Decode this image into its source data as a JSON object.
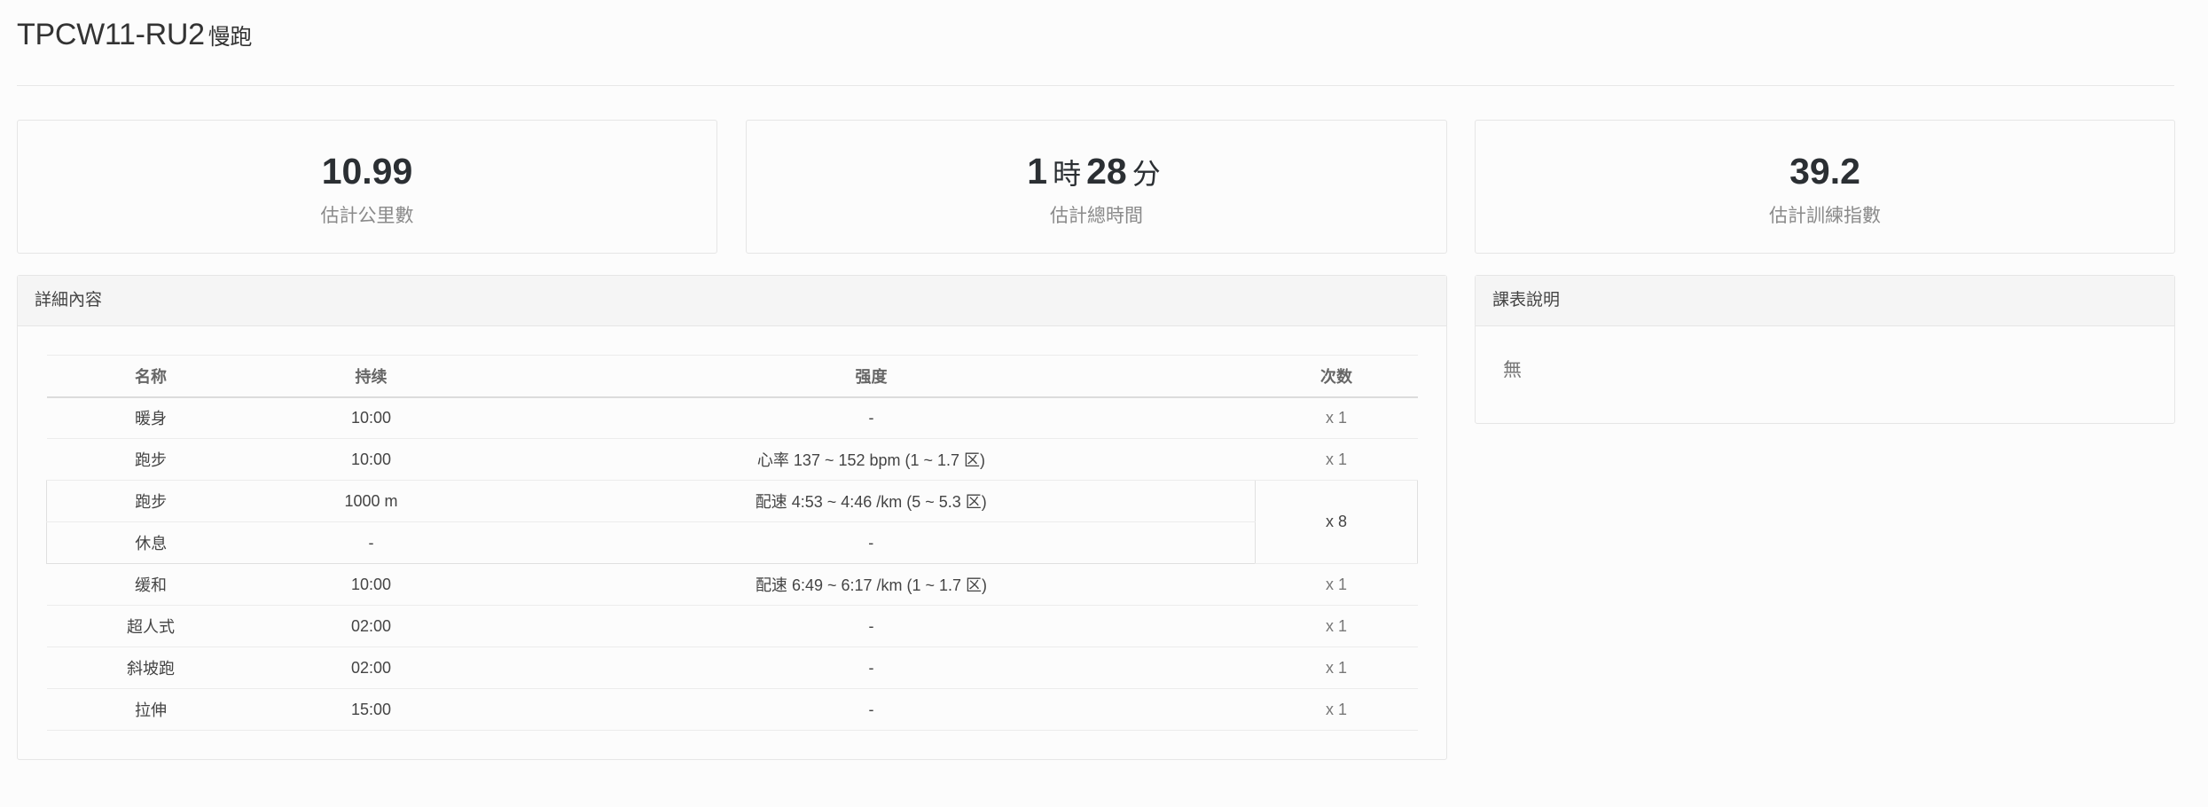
{
  "header": {
    "code": "TPCW11-RU2",
    "type": "慢跑"
  },
  "stats": {
    "distance": {
      "value": "10.99",
      "label": "估計公里數"
    },
    "duration": {
      "hours": "1",
      "hours_unit": "時",
      "minutes": "28",
      "minutes_unit": "分",
      "label": "估計總時間"
    },
    "training_index": {
      "value": "39.2",
      "label": "估計訓練指數"
    }
  },
  "details": {
    "heading": "詳細內容",
    "columns": [
      "名称",
      "持续",
      "强度",
      "次数"
    ],
    "rows": [
      {
        "name": "暖身",
        "duration": "10:00",
        "intensity": "-",
        "count": "x 1"
      },
      {
        "name": "跑步",
        "duration": "10:00",
        "intensity": "心率 137 ~ 152 bpm (1 ~ 1.7 区)",
        "count": "x 1"
      },
      {
        "name": "跑步",
        "duration": "1000 m",
        "intensity": "配速 4:53 ~ 4:46 /km (5 ~ 5.3 区)",
        "count": "x 8"
      },
      {
        "name": "休息",
        "duration": "-",
        "intensity": "-"
      },
      {
        "name": "缓和",
        "duration": "10:00",
        "intensity": "配速 6:49 ~ 6:17 /km (1 ~ 1.7 区)",
        "count": "x 1"
      },
      {
        "name": "超人式",
        "duration": "02:00",
        "intensity": "-",
        "count": "x 1"
      },
      {
        "name": "斜坡跑",
        "duration": "02:00",
        "intensity": "-",
        "count": "x 1"
      },
      {
        "name": "拉伸",
        "duration": "15:00",
        "intensity": "-",
        "count": "x 1"
      }
    ]
  },
  "description": {
    "heading": "課表說明",
    "text": "無"
  }
}
